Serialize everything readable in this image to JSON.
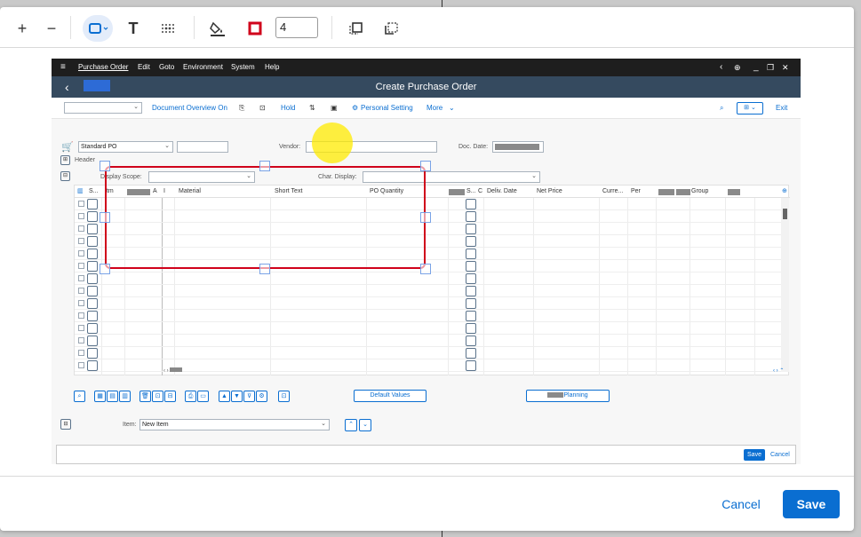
{
  "toolbar": {
    "zoom_in_label": "+",
    "zoom_out_label": "−",
    "text_tool_label": "T",
    "stroke_width": "4"
  },
  "sap": {
    "menu": [
      "Purchase Order",
      "Edit",
      "Goto",
      "Environment",
      "System",
      "Help"
    ],
    "title": "Create Purchase Order",
    "toolbar": {
      "document_overview": "Document Overview On",
      "hold": "Hold",
      "personal_setting": "Personal Setting",
      "more": "More",
      "exit": "Exit"
    },
    "header": {
      "doc_type": "Standard PO",
      "vendor_label": "Vendor:",
      "doc_date_label": "Doc. Date:",
      "header_label": "Header"
    },
    "items": {
      "display_scope_label": "Display Scope:",
      "char_display_label": "Char. Display:",
      "columns": [
        "S...",
        "Itm",
        "A",
        "I",
        "Material",
        "Short Text",
        "PO Quantity",
        "S...",
        "C",
        "Deliv. Date",
        "Net Price",
        "Curre...",
        "Per",
        "Group"
      ],
      "default_values_button": "Default Values",
      "planning_button": "Planning",
      "item_label": "Item:",
      "item_value": "New Item"
    },
    "statusbar": {
      "save": "Save",
      "cancel": "Cancel"
    }
  },
  "footer": {
    "cancel_label": "Cancel",
    "save_label": "Save"
  },
  "colors": {
    "accent": "#0a6ed1",
    "sap_title_bar": "#354a5f",
    "annotation_red": "#d0021b",
    "highlight_yellow": "#ffeb00"
  }
}
